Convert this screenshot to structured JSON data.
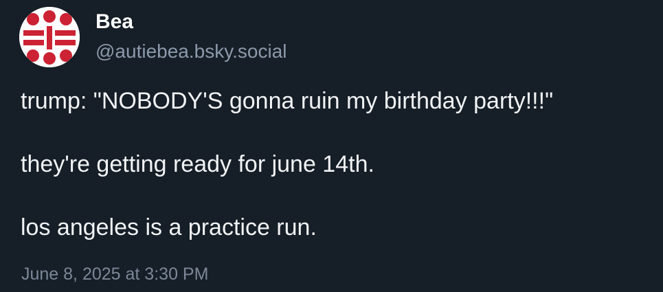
{
  "author": {
    "display_name": "Bea",
    "handle": "@autiebea.bsky.social",
    "avatar_icon": "avatar-icon",
    "avatar_colors": {
      "primary": "#cc2233",
      "background": "#ffffff"
    }
  },
  "post": {
    "paragraphs": [
      "trump: \"NOBODY'S gonna ruin my birthday party!!!\"",
      "they're getting ready for june 14th.",
      "los angeles is a practice run."
    ],
    "timestamp": "June 8, 2025 at 3:30 PM"
  },
  "colors": {
    "background": "#161e27",
    "text": "#f1f3f5",
    "muted": "#8c9aab"
  }
}
